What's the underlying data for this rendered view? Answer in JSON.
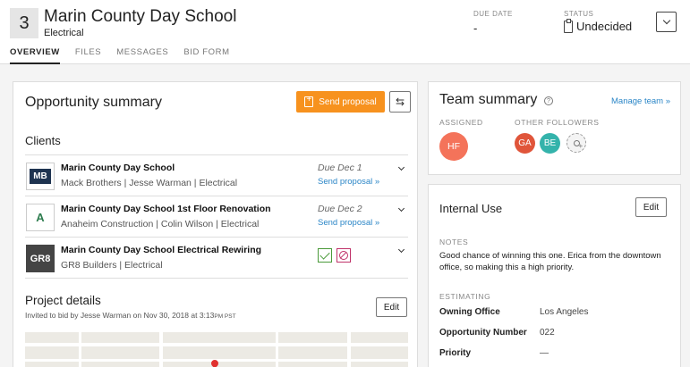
{
  "header": {
    "number": "3",
    "title": "Marin County Day School",
    "trade": "Electrical",
    "due_date_label": "DUE DATE",
    "due_date_value": "-",
    "status_label": "STATUS",
    "status_value": "Undecided"
  },
  "tabs": [
    {
      "label": "OVERVIEW",
      "active": true
    },
    {
      "label": "FILES",
      "active": false
    },
    {
      "label": "MESSAGES",
      "active": false
    },
    {
      "label": "BID FORM",
      "active": false
    }
  ],
  "opportunity": {
    "title": "Opportunity summary",
    "send_proposal_label": "Send proposal",
    "clients_label": "Clients",
    "clients": [
      {
        "logo_text": "MB",
        "name": "Marin County Day School",
        "subtitle": "Mack Brothers  |  Jesse Warman  |  Electrical",
        "due": "Due Dec 1",
        "link": "Send proposal »"
      },
      {
        "logo_text": "A",
        "name": "Marin County Day School 1st Floor Renovation",
        "subtitle": "Anaheim Construction  |  Colin Wilson  |  Electrical",
        "due": "Due Dec 2",
        "link": "Send proposal »"
      },
      {
        "logo_text": "GR8",
        "name": "Marin County Day School Electrical Rewiring",
        "subtitle": "GR8 Builders  |  Electrical"
      }
    ],
    "project_details_title": "Project details",
    "project_details_sub": "Invited to bid by Jesse Warman on Nov 30, 2018 at 3:13",
    "project_details_tz": "PM PST",
    "edit_label": "Edit"
  },
  "team": {
    "title": "Team summary",
    "manage_link": "Manage team »",
    "assigned_label": "ASSIGNED",
    "followers_label": "OTHER FOLLOWERS",
    "assigned": [
      {
        "initials": "HF",
        "color": "#f4735a"
      }
    ],
    "followers": [
      {
        "initials": "GA",
        "color": "#e0553a"
      },
      {
        "initials": "BE",
        "color": "#34b3ab"
      }
    ]
  },
  "internal": {
    "title": "Internal Use",
    "edit_label": "Edit",
    "notes_label": "NOTES",
    "notes_text": "Good chance of winning this one. Erica from the downtown office, so making this a high priority.",
    "estimating_label": "ESTIMATING",
    "fields": [
      {
        "key": "Owning Office",
        "value": "Los Angeles"
      },
      {
        "key": "Opportunity Number",
        "value": "022"
      },
      {
        "key": "Priority",
        "value": "—"
      }
    ]
  },
  "colors": {
    "accent_orange": "#f7921e",
    "link_blue": "#2b86c7"
  }
}
